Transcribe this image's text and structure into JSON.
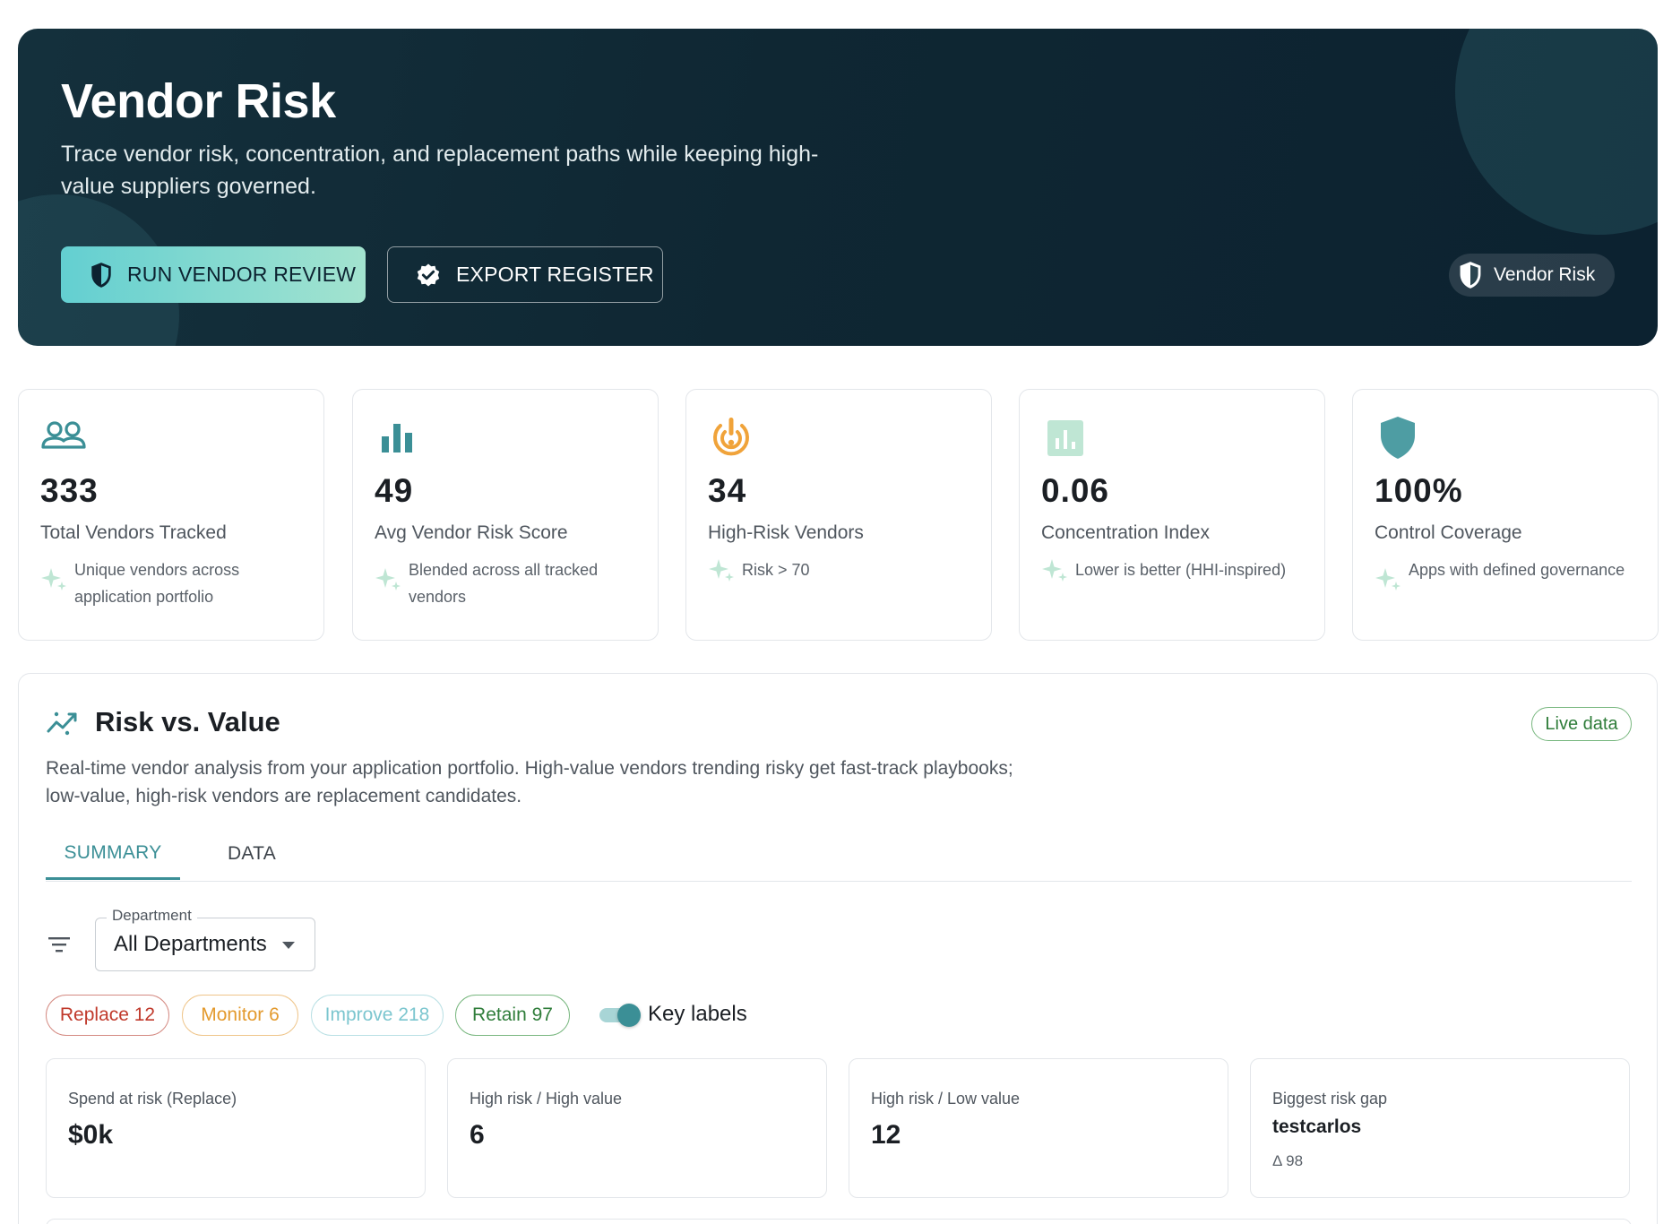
{
  "hero": {
    "title": "Vendor Risk",
    "subtitle": "Trace vendor risk, concentration, and replacement paths while keeping high-value suppliers governed.",
    "primary_button": "RUN VENDOR REVIEW",
    "secondary_button": "EXPORT REGISTER",
    "chip": "Vendor Risk",
    "colors": {
      "background": "#0f2733",
      "accent": "#63cfd1"
    }
  },
  "kpis": [
    {
      "icon": "users-icon",
      "value": "333",
      "label": "Total Vendors Tracked",
      "hint": "Unique vendors across application portfolio",
      "color": "#3b8f96"
    },
    {
      "icon": "bar-chart-icon",
      "value": "49",
      "label": "Avg Vendor Risk Score",
      "hint": "Blended across all tracked vendors",
      "color": "#3b8f96"
    },
    {
      "icon": "target-alert-icon",
      "value": "34",
      "label": "High-Risk Vendors",
      "hint": "Risk > 70",
      "color": "#f0a33a"
    },
    {
      "icon": "chart-box-icon",
      "value": "0.06",
      "label": "Concentration Index",
      "hint": "Lower is better (HHI-inspired)",
      "color": "#bfe6d4"
    },
    {
      "icon": "shield-icon",
      "value": "100%",
      "label": "Control Coverage",
      "hint": "Apps with defined governance",
      "color": "#4e9da3"
    }
  ],
  "panel": {
    "title": "Risk vs. Value",
    "live_chip": "Live data",
    "description": "Real-time vendor analysis from your application portfolio. High-value vendors trending risky get fast-track playbooks; low-value, high-risk vendors are replacement candidates.",
    "tabs": [
      {
        "label": "SUMMARY",
        "active": true
      },
      {
        "label": "DATA",
        "active": false
      }
    ],
    "department": {
      "label": "Department",
      "value": "All Departments"
    },
    "chips": [
      {
        "label": "Replace 12",
        "color": "#c0392b"
      },
      {
        "label": "Monitor 6",
        "color": "#e39a2e"
      },
      {
        "label": "Improve 218",
        "color": "#7cc6cf"
      },
      {
        "label": "Retain 97",
        "color": "#2f7d3a"
      }
    ],
    "key_labels": {
      "label": "Key labels",
      "on": true
    },
    "stats": [
      {
        "label": "Spend at risk (Replace)",
        "value": "$0k"
      },
      {
        "label": "High risk / High value",
        "value": "6"
      },
      {
        "label": "High risk / Low value",
        "value": "12"
      },
      {
        "label": "Biggest risk gap",
        "name": "testcarlos",
        "delta": "Δ 98"
      }
    ]
  }
}
